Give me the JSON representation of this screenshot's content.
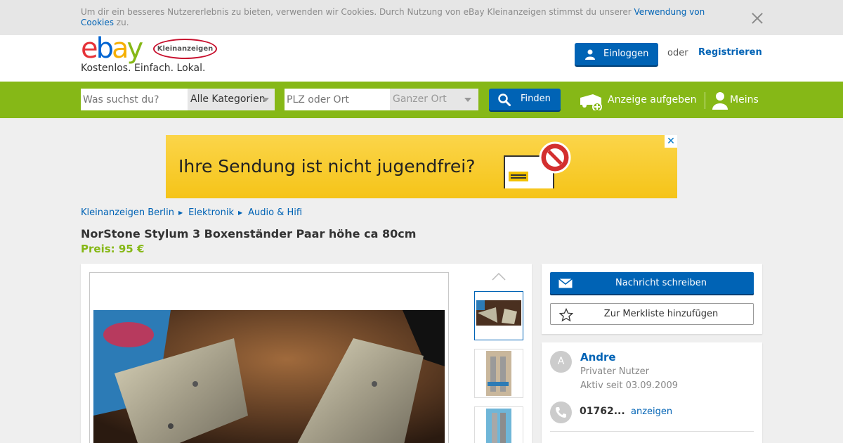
{
  "cookie_banner": {
    "text": "Um dir ein besseres Nutzererlebnis zu bieten, verwenden wir Cookies. Durch Nutzung von eBay Kleinanzeigen stimmst du unserer ",
    "link": "Verwendung von Cookies",
    "suffix": " zu."
  },
  "header": {
    "logo_e": "e",
    "logo_b": "b",
    "logo_a": "a",
    "logo_y": "y",
    "badge": "Kleinanzeigen",
    "slogan": "Kostenlos. Einfach. Lokal.",
    "login_label": "Einloggen",
    "or_label": "oder",
    "register_label": "Registrieren"
  },
  "search": {
    "query_placeholder": "Was suchst du?",
    "category_value": "Alle Kategorien",
    "location_placeholder": "PLZ oder Ort",
    "radius_value": "Ganzer Ort",
    "find_label": "Finden",
    "post_ad_label": "Anzeige aufgeben",
    "mine_label": "Meins"
  },
  "ad_banner": {
    "text": "Ihre Sendung ist nicht jugendfrei?",
    "close": "✕"
  },
  "breadcrumbs": [
    "Kleinanzeigen Berlin",
    "Elektronik",
    "Audio & Hifi"
  ],
  "listing": {
    "title": "NorStone Stylum 3 Boxenständer Paar höhe ca 80cm",
    "price": "Preis: 95 €"
  },
  "actions": {
    "message_label": "Nachricht schreiben",
    "watchlist_label": "Zur Merkliste hinzufügen"
  },
  "seller": {
    "initial": "A",
    "name": "Andre",
    "type": "Privater Nutzer",
    "active_since": "Aktiv seit 03.09.2009",
    "phone": "01762...",
    "phone_reveal": "anzeigen"
  },
  "colors": {
    "brand_green": "#86b817",
    "brand_blue": "#0063b5",
    "cookie_bg": "#e6e6e6",
    "page_bg": "#efefef"
  }
}
